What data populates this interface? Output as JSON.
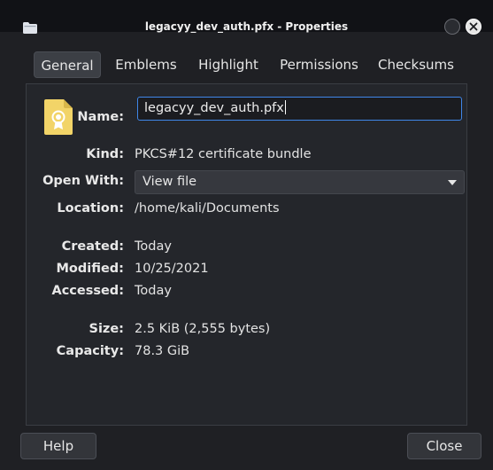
{
  "window": {
    "title": "legacyy_dev_auth.pfx - Properties"
  },
  "tabs": [
    {
      "label": "General",
      "active": true
    },
    {
      "label": "Emblems",
      "active": false
    },
    {
      "label": "Highlight",
      "active": false
    },
    {
      "label": "Permissions",
      "active": false
    },
    {
      "label": "Checksums",
      "active": false
    }
  ],
  "general": {
    "name_label": "Name:",
    "name_value": "legacyy_dev_auth.pfx",
    "kind_label": "Kind:",
    "kind_value": "PKCS#12 certificate bundle",
    "open_with_label": "Open With:",
    "open_with_value": "View file",
    "location_label": "Location:",
    "location_value": "/home/kali/Documents",
    "created_label": "Created:",
    "created_value": "Today",
    "modified_label": "Modified:",
    "modified_value": "10/25/2021",
    "accessed_label": "Accessed:",
    "accessed_value": "Today",
    "size_label": "Size:",
    "size_value": "2.5 KiB (2,555 bytes)",
    "capacity_label": "Capacity:",
    "capacity_value": "78.3 GiB"
  },
  "buttons": {
    "help": "Help",
    "close": "Close"
  },
  "colors": {
    "accent": "#3f86e8",
    "file_icon": "#f2d468"
  }
}
